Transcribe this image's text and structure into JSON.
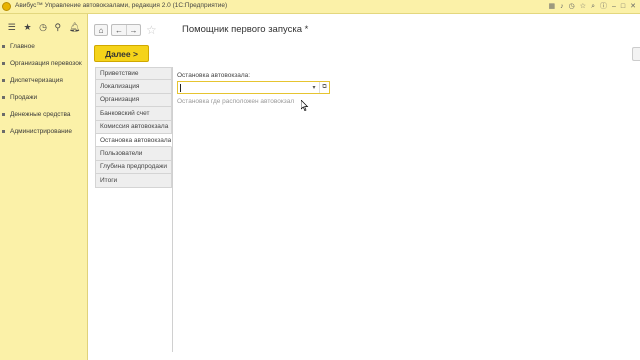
{
  "window": {
    "title": "Авибус™ Управление автовокзалами, редакция 2.0  (1С:Предприятие)",
    "title_icons": [
      "grid-icon",
      "bell-icon",
      "history-icon",
      "star-icon",
      "zoom-icon",
      "info-icon",
      "minimize-icon",
      "maximize-icon",
      "close-icon"
    ]
  },
  "left_panel": {
    "toolbar": [
      "menu-icon",
      "favorites-star-icon",
      "history-icon",
      "search-icon",
      "notifications-bell-icon"
    ],
    "sections": [
      {
        "label": "Главное"
      },
      {
        "label": "Организация перевозок"
      },
      {
        "label": "Диспетчеризация"
      },
      {
        "label": "Продажи"
      },
      {
        "label": "Денежные средства"
      },
      {
        "label": "Администрирование"
      }
    ]
  },
  "form": {
    "title": "Помощник первого запуска *",
    "next_button": "Далее >",
    "steps": [
      {
        "label": "Приветствие",
        "active": false
      },
      {
        "label": "Локализация",
        "active": false
      },
      {
        "label": "Организация",
        "active": false
      },
      {
        "label": "Банковский счет",
        "active": false
      },
      {
        "label": "Комиссия автовокзала",
        "active": false
      },
      {
        "label": "Остановка автовокзала",
        "active": true
      },
      {
        "label": "Пользователи",
        "active": false
      },
      {
        "label": "Глубина предпродажи",
        "active": false
      },
      {
        "label": "Итоги",
        "active": false
      }
    ],
    "field": {
      "label": "Остановка автовокзала:",
      "value": "",
      "hint": "Остановка где расположен автовокзал"
    }
  },
  "colors": {
    "panel_yellow": "#fbf1a8",
    "button_yellow": "#f5d31a",
    "field_border": "#e6c430"
  }
}
